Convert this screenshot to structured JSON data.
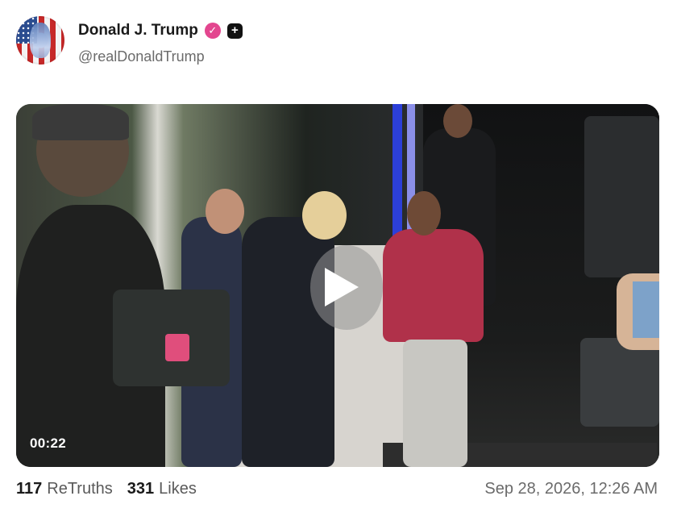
{
  "post": {
    "author": {
      "display_name": "Donald J. Trump",
      "handle": "@realDonaldTrump",
      "verified_icon": "verified-check-icon",
      "plus_icon": "plus-badge-icon"
    },
    "video": {
      "duration": "00:22",
      "play_icon": "play-icon"
    },
    "stats": {
      "retruths_count": "117",
      "retruths_label": "ReTruths",
      "likes_count": "331",
      "likes_label": "Likes"
    },
    "timestamp": "Sep 28, 2026, 12:26 AM"
  },
  "colors": {
    "verified": "#e3468f",
    "text_primary": "#1a1a1a",
    "text_secondary": "#6b6b6b"
  }
}
